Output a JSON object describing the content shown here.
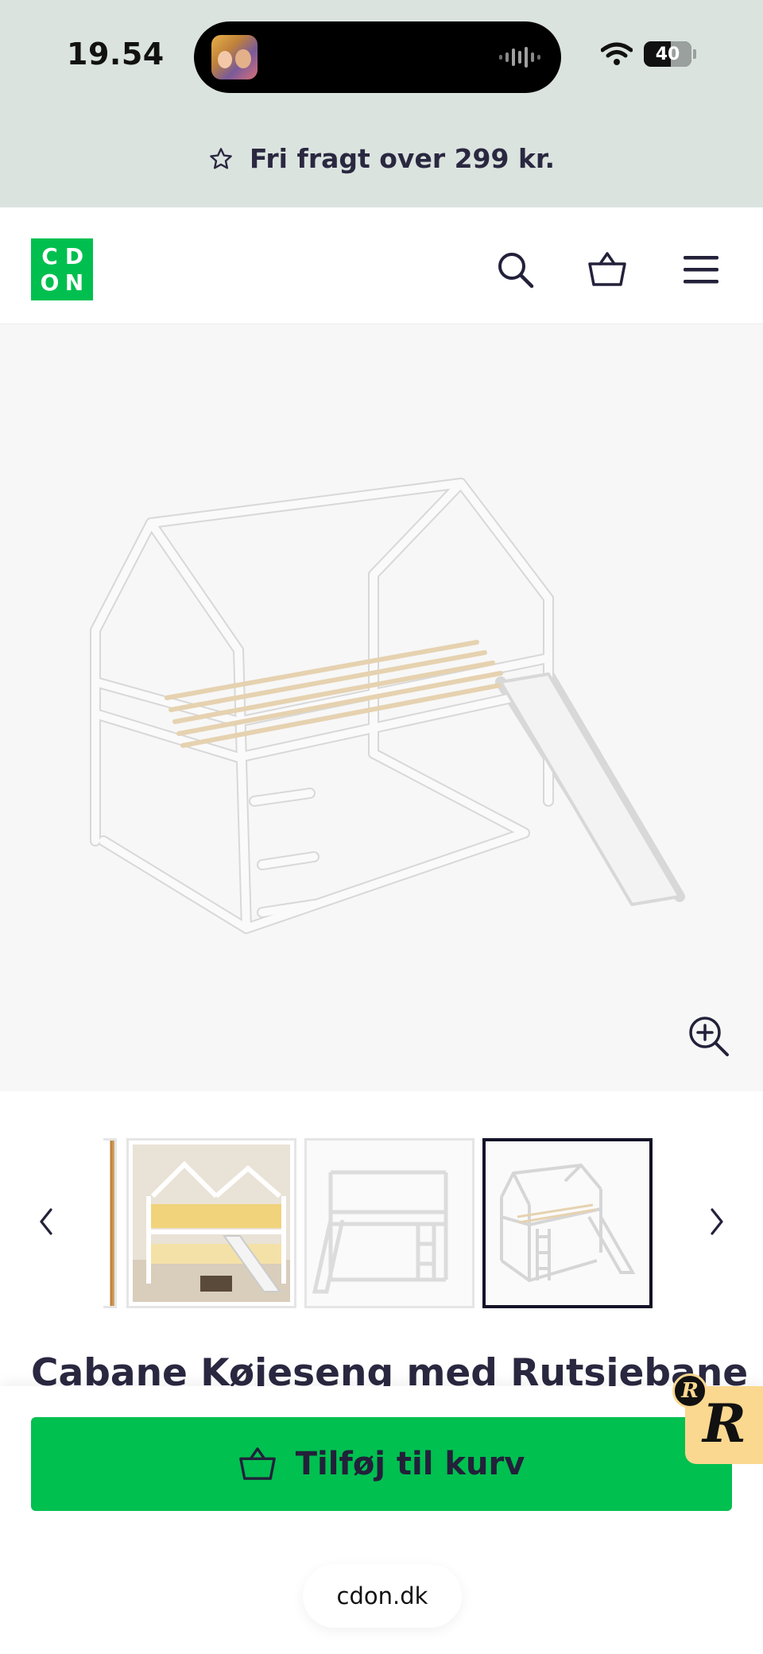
{
  "status_bar": {
    "time": "19.54",
    "battery": "40",
    "now_playing_art": "HYPERSQUAD"
  },
  "promo": {
    "icon": "star-icon",
    "text": "Fri fragt over 299 kr."
  },
  "header": {
    "logo": [
      "C",
      "D",
      "O",
      "N"
    ],
    "icons": [
      "search-icon",
      "basket-icon",
      "menu-icon"
    ]
  },
  "gallery": {
    "main_image": "white-house-bunk-bed-with-slide",
    "thumbnails": [
      {
        "image": "bunk-bed-room-scene",
        "selected": false
      },
      {
        "image": "bunk-bed-side-view",
        "selected": false
      },
      {
        "image": "bunk-bed-white-background",
        "selected": true
      }
    ],
    "prev_icon": "chevron-left-icon",
    "next_icon": "chevron-right-icon",
    "zoom_icon": "zoom-in-icon"
  },
  "product": {
    "title": "Cabane Køjeseng med Rutsjebane og"
  },
  "actions": {
    "add_to_cart": "Tilføj til kurv"
  },
  "badge": {
    "letter": "R"
  },
  "browser": {
    "url": "cdon.dk"
  },
  "colors": {
    "brand_green": "#00c050",
    "top_band": "#dbe3df",
    "text_dark": "#23213a"
  }
}
